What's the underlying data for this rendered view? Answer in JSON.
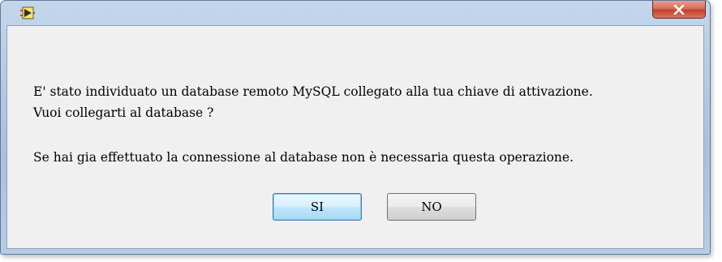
{
  "window": {
    "title": "",
    "app_icon": "labview-vi-icon",
    "close_icon": "close-x-icon"
  },
  "dialog": {
    "message_line1": "E' stato individuato un database remoto MySQL collegato alla tua chiave di attivazione.",
    "message_line2": "Vuoi collegarti al database ?",
    "message_line3": "Se hai gia effettuato la connessione al database non è necessaria questa operazione."
  },
  "buttons": {
    "yes_label": "SI",
    "no_label": "NO"
  },
  "colors": {
    "close_button": "#c7432c",
    "default_button_border": "#3c7fb1",
    "client_background": "#f0f0f0"
  }
}
